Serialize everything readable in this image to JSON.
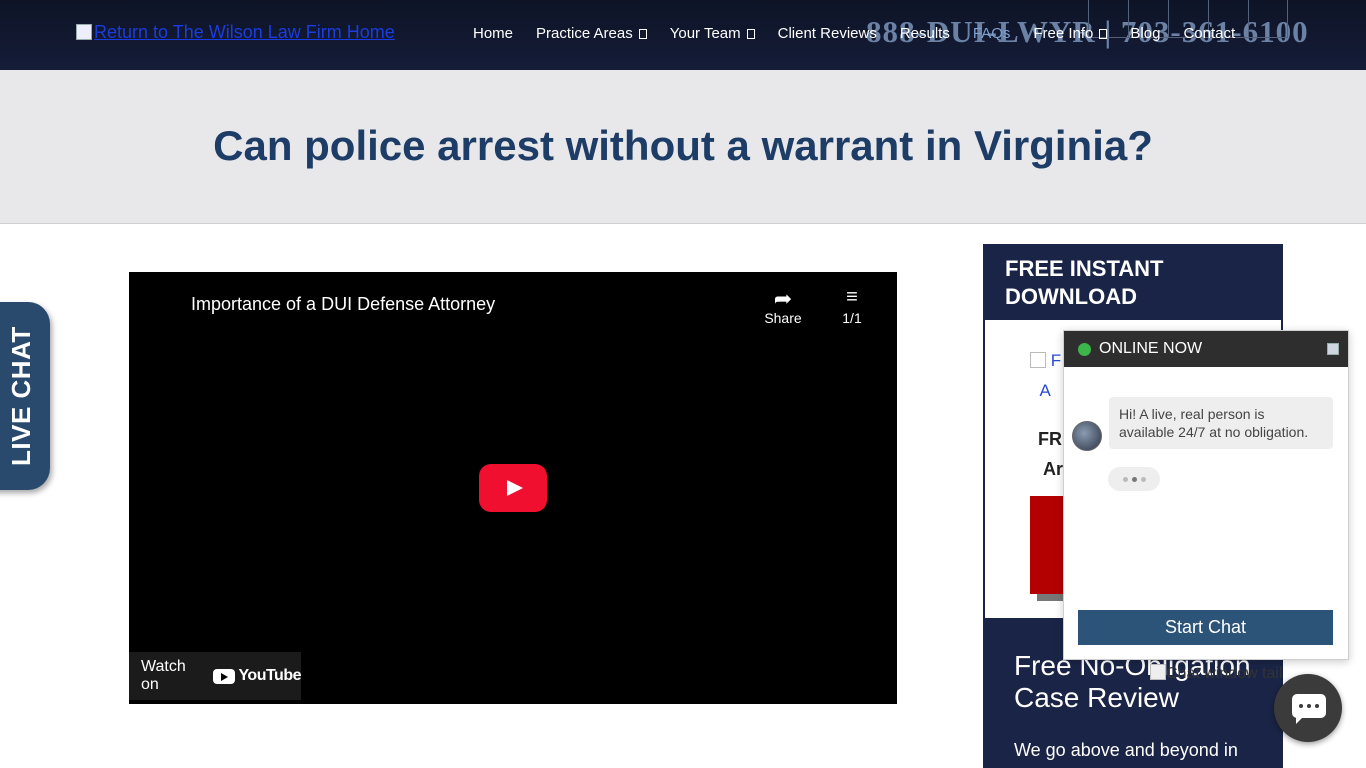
{
  "header": {
    "logo_alt": "Return to The Wilson Law Firm Home",
    "phone": "888-DUI-LWYR | 703-361-6100",
    "social_icons": [
      "facebook-icon",
      "twitter-icon",
      "linkedin-icon",
      "youtube-icon",
      "instagram-icon"
    ],
    "social_glyphs": [
      "",
      "",
      "",
      "",
      ""
    ],
    "nav": [
      {
        "label": "Home",
        "dropdown": false
      },
      {
        "label": "Practice Areas",
        "dropdown": true
      },
      {
        "label": "Your Team",
        "dropdown": true
      },
      {
        "label": "Client Reviews",
        "dropdown": false
      },
      {
        "label": "Results",
        "dropdown": false
      },
      {
        "label": "FAQs",
        "dropdown": false,
        "active": true
      },
      {
        "label": "Free Info",
        "dropdown": true
      },
      {
        "label": "Blog",
        "dropdown": false
      },
      {
        "label": "Contact",
        "dropdown": false
      }
    ]
  },
  "page": {
    "title": "Can police arrest without a warrant in Virginia?"
  },
  "video": {
    "title": "Importance of a DUI Defense Attorney",
    "share_label": "Share",
    "playlist_label": "1/1",
    "watch_on": "Watch on",
    "youtube_label": "YouTube"
  },
  "live_chat_tab": {
    "label": "LIVE CHAT"
  },
  "sidebar": {
    "heading": "FREE INSTANT DOWNLOAD",
    "image_alt_line1": "F",
    "image_alt_line2": "A",
    "text_line1": "FR",
    "text_line2": "Ar",
    "case_review_title": "Free No-Obligation Case Review",
    "case_review_text": "We go above and beyond in"
  },
  "chat": {
    "status": "ONLINE NOW",
    "message": "Hi! A live, real person is available 24/7 at no obligation.",
    "start_button": "Start Chat",
    "tail_alt": "Chat window tail"
  },
  "colors": {
    "header_bg": "#141c38",
    "title_color": "#1d3c66",
    "sidebar_bg": "#1a2446",
    "chat_button": "#2b5478",
    "online_dot": "#3cb54a",
    "youtube_red": "#f00f2f"
  }
}
